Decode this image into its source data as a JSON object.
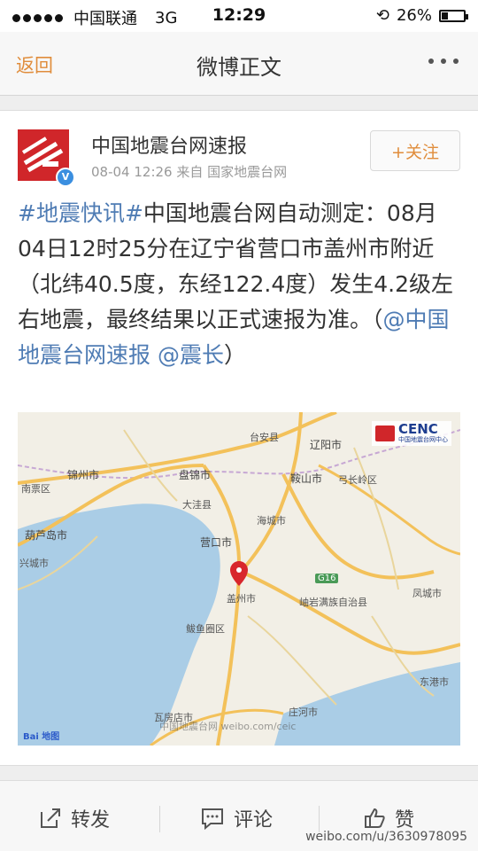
{
  "status_bar": {
    "carrier": "中国联通",
    "network": "3G",
    "time": "12:29",
    "battery": "26%"
  },
  "nav": {
    "back_label": "返回",
    "title": "微博正文"
  },
  "post": {
    "author": "中国地震台网速报",
    "meta": "08-04 12:26  来自 国家地震台网",
    "follow_label": "+关注",
    "text_tag": "#地震快讯#",
    "text_body": "中国地震台网自动测定：08月04日12时25分在辽宁省营口市盖州市附近（北纬40.5度，东经122.4度）发生4.2级左右地震，最终结果以正式速报为准。（",
    "mention_1": "@中国地震台网速报",
    "mention_2": "@震长",
    "text_end": "）"
  },
  "map": {
    "brand": "CENC",
    "brand_sub": "中国地震台网中心",
    "labels": {
      "taian": "台安县",
      "liaoyang": "辽阳市",
      "jinzhou": "锦州市",
      "panjin": "盘锦市",
      "anshan": "鞍山市",
      "gongchangling": "弓长岭区",
      "nanpiao": "南票区",
      "dawa": "大洼县",
      "haicheng": "海城市",
      "huludao": "葫芦岛市",
      "yingkou": "营口市",
      "xingcheng": "兴城市",
      "gaizhou": "盖州市",
      "xiuyan": "岫岩满族自治县",
      "fengcheng": "凤城市",
      "bayuquan": "鲅鱼圈区",
      "donggang": "东港市",
      "wafangdian": "瓦房店市",
      "zhuanghe": "庄河市"
    },
    "road": "G16",
    "watermark": "中国地震台网 weibo.com/ceic",
    "baidu": "Bai 地图"
  },
  "actions": {
    "repost": "转发",
    "comment": "评论",
    "like": "赞"
  },
  "footer_watermark": "weibo.com/u/3630978095",
  "colors": {
    "accent": "#e08d3c",
    "link": "#4f7cb4",
    "brand_red": "#d0262a",
    "sea": "#aacde6",
    "land": "#f2efe6"
  }
}
